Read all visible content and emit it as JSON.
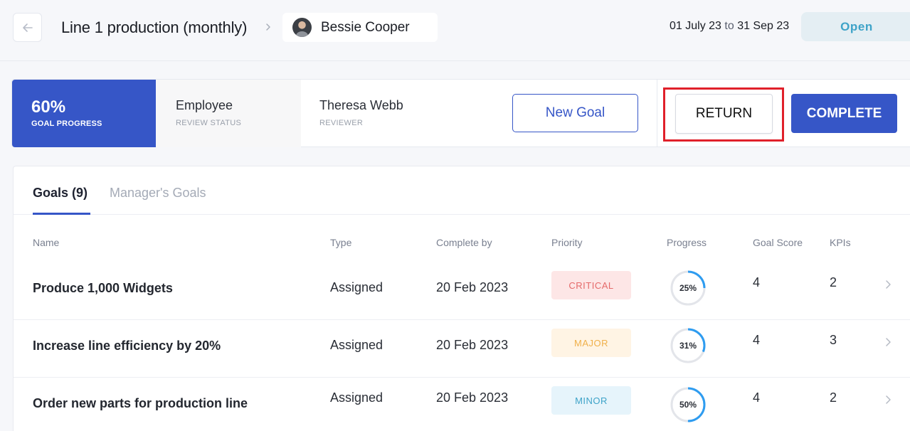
{
  "header": {
    "title": "Line 1 production (monthly)",
    "employee_name": "Bessie Cooper",
    "date_from": "01 July 23",
    "date_sep": "to",
    "date_to": "31 Sep 23",
    "status": "Open"
  },
  "summary": {
    "goal_progress_value": "60%",
    "goal_progress_label": "GOAL PROGRESS",
    "review_status_value": "Employee",
    "review_status_label": "REVIEW STATUS",
    "reviewer_value": "Theresa Webb",
    "reviewer_label": "REVIEWER",
    "new_goal_label": "New Goal",
    "return_label": "RETURN",
    "complete_label": "COMPLETE"
  },
  "tabs": [
    {
      "label": "Goals (9)",
      "active": true
    },
    {
      "label": "Manager's Goals",
      "active": false
    }
  ],
  "columns": {
    "name": "Name",
    "type": "Type",
    "complete_by": "Complete by",
    "priority": "Priority",
    "progress": "Progress",
    "goal_score": "Goal Score",
    "kpis": "KPIs"
  },
  "goals": [
    {
      "name": "Produce 1,000 Widgets",
      "type": "Assigned",
      "complete_by": "20 Feb 2023",
      "priority": "CRITICAL",
      "progress_label": "25%",
      "progress": 0.25,
      "goal_score": "4",
      "kpis": "2"
    },
    {
      "name": "Increase line efficiency by 20%",
      "type": "Assigned",
      "complete_by": "20 Feb 2023",
      "priority": "MAJOR",
      "progress_label": "31%",
      "progress": 0.31,
      "goal_score": "4",
      "kpis": "3"
    },
    {
      "name": "Order new parts for production line",
      "type": "Assigned",
      "complete_by": "20 Feb 2023",
      "priority": "MINOR",
      "progress_label": "50%",
      "progress": 0.5,
      "goal_score": "4",
      "kpis": "2"
    }
  ],
  "colors": {
    "accent": "#3656c7",
    "highlight": "#e0202a",
    "status_open": "#3ea3c8",
    "progress_ring": "#2e9cf0",
    "critical_bg": "#fde6e6",
    "critical_fg": "#e56a6a",
    "major_bg": "#fff4e4",
    "major_fg": "#f0b04a",
    "minor_bg": "#e6f4fb",
    "minor_fg": "#3ea3c8"
  },
  "icons": {
    "back": "arrow-left-icon",
    "breadcrumb": "chevron-right-icon",
    "row": "chevron-right-icon"
  }
}
